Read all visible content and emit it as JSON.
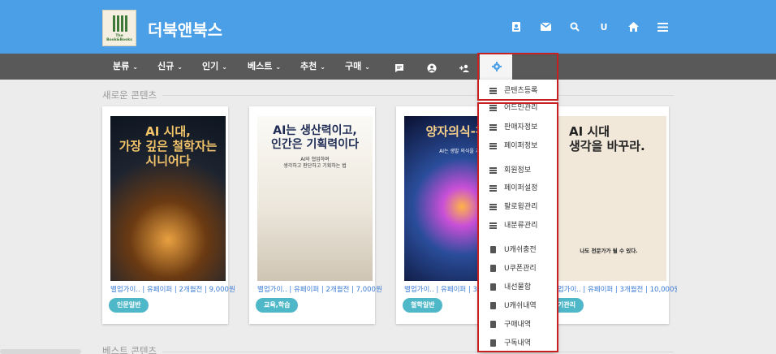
{
  "site": {
    "title": "더북앤북스",
    "logo_text": "The Book&Books"
  },
  "header_icons": [
    "contacts-icon",
    "mail-icon",
    "search-icon",
    "u-icon",
    "home-icon",
    "menu-icon"
  ],
  "header_u_label": "U",
  "nav": {
    "items": [
      {
        "label": "분류",
        "chevron": "⌄"
      },
      {
        "label": "신규",
        "chevron": "⌄"
      },
      {
        "label": "인기",
        "chevron": "⌄"
      },
      {
        "label": "베스트",
        "chevron": "⌄"
      },
      {
        "label": "추천",
        "chevron": "⌄"
      },
      {
        "label": "구매",
        "chevron": "⌄"
      }
    ],
    "icons": [
      "chat-icon",
      "user-icon",
      "add-user-icon",
      "gear-icon"
    ]
  },
  "sections": {
    "new": "새로운 콘텐츠",
    "best": "베스트 콘텐츠"
  },
  "cards": [
    {
      "title": "AI 시대,\n가장 깊은 철학자는\n시니어다",
      "meta": "밸업가이.. | 유페이퍼 | 2개월전 | 9,000원",
      "tag": "인문일반"
    },
    {
      "title": "AI는 생산력이고,\n인간은 기획력이다",
      "subtitle": "AI와 협업하며\n생각하고 판단하고 기획하는 법",
      "meta": "밸업가이.. | 유페이퍼 | 2개월전 | 7,000원",
      "tag": "교육,학습"
    },
    {
      "title": "양자의식-찬반",
      "subtitle": "AI는 생발 의식을 가질",
      "meta": "밸업가이.. | 유페이퍼 | 3개월전",
      "tag": "철학일반"
    },
    {
      "title": "AI 시대\n생각을 바꾸라.",
      "subtitle": "나도 전문가가 될 수 있다.",
      "meta": "밸업가이.. | 유페이퍼 | 3개월전 | 10,000원",
      "tag": "기관리"
    }
  ],
  "dropdown": {
    "items": [
      {
        "label": "콘텐츠등록",
        "icon": "menu-lines-icon"
      },
      {
        "label": "어드민관리",
        "icon": "menu-lines-icon"
      },
      {
        "label": "판매자정보",
        "icon": "menu-lines-icon"
      },
      {
        "label": "페이퍼정보",
        "icon": "menu-lines-icon"
      },
      {
        "label": "회원정보",
        "icon": "menu-lines-icon"
      },
      {
        "label": "페이퍼설정",
        "icon": "menu-lines-icon"
      },
      {
        "label": "팔로윙관리",
        "icon": "menu-lines-icon"
      },
      {
        "label": "내분류관리",
        "icon": "menu-lines-icon"
      },
      {
        "label": "U캐쉬충전",
        "icon": "document-icon"
      },
      {
        "label": "U쿠폰관리",
        "icon": "document-icon"
      },
      {
        "label": "내선물함",
        "icon": "document-icon"
      },
      {
        "label": "U캐쉬내역",
        "icon": "document-icon"
      },
      {
        "label": "구매내역",
        "icon": "document-icon"
      },
      {
        "label": "구독내역",
        "icon": "document-icon"
      }
    ]
  },
  "colors": {
    "header": "#4a9fe6",
    "nav": "#595959",
    "tag": "#4fb8c8",
    "highlight": "#c62020",
    "meta": "#3a7bd5"
  }
}
